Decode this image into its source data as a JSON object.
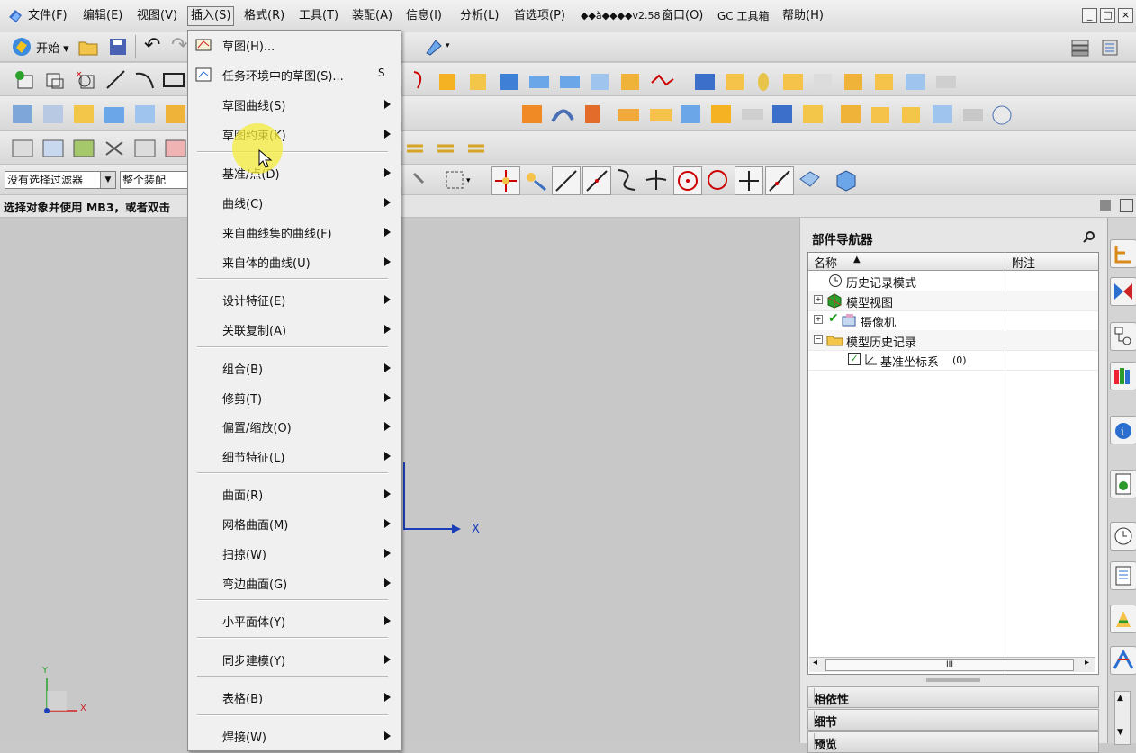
{
  "menubar": {
    "items": [
      "文件(F)",
      "编辑(E)",
      "视图(V)",
      "插入(S)",
      "格式(R)",
      "工具(T)",
      "装配(A)",
      "信息(I)",
      "分析(L)",
      "首选项(P)",
      "◆◆à◆◆◆◆v2.58",
      "窗口(O)",
      "GC 工具箱",
      "帮助(H)"
    ],
    "window_buttons": [
      "_",
      "□",
      "×"
    ]
  },
  "toolbar": {
    "start_label": "开始",
    "filter_value": "没有选择过滤器",
    "scope_value": "整个装配"
  },
  "status": {
    "text": "选择对象并使用 MB3，或者双击"
  },
  "insert_menu": {
    "items": [
      {
        "label": "草图(H)...",
        "shortcut": "",
        "sub": false
      },
      {
        "label": "任务环境中的草图(S)...",
        "shortcut": "S",
        "sub": false
      },
      {
        "label": "草图曲线(S)",
        "shortcut": "",
        "sub": true
      },
      {
        "label": "草图约束(K)",
        "shortcut": "",
        "sub": true
      },
      {
        "label": "基准/点(D)",
        "shortcut": "",
        "sub": true
      },
      {
        "label": "曲线(C)",
        "shortcut": "",
        "sub": true
      },
      {
        "label": "来自曲线集的曲线(F)",
        "shortcut": "",
        "sub": true
      },
      {
        "label": "来自体的曲线(U)",
        "shortcut": "",
        "sub": true
      },
      {
        "label": "设计特征(E)",
        "shortcut": "",
        "sub": true
      },
      {
        "label": "关联复制(A)",
        "shortcut": "",
        "sub": true
      },
      {
        "label": "组合(B)",
        "shortcut": "",
        "sub": true
      },
      {
        "label": "修剪(T)",
        "shortcut": "",
        "sub": true
      },
      {
        "label": "偏置/缩放(O)",
        "shortcut": "",
        "sub": true
      },
      {
        "label": "细节特征(L)",
        "shortcut": "",
        "sub": true
      },
      {
        "label": "曲面(R)",
        "shortcut": "",
        "sub": true
      },
      {
        "label": "网格曲面(M)",
        "shortcut": "",
        "sub": true
      },
      {
        "label": "扫掠(W)",
        "shortcut": "",
        "sub": true
      },
      {
        "label": "弯边曲面(G)",
        "shortcut": "",
        "sub": true
      },
      {
        "label": "小平面体(Y)",
        "shortcut": "",
        "sub": true
      },
      {
        "label": "同步建模(Y)",
        "shortcut": "",
        "sub": true
      },
      {
        "label": "表格(B)",
        "shortcut": "",
        "sub": true
      },
      {
        "label": "焊接(W)",
        "shortcut": "",
        "sub": true
      }
    ]
  },
  "navigator": {
    "title": "部件导航器",
    "col_name": "名称",
    "col_note": "附注",
    "rows": [
      {
        "label": "历史记录模式",
        "extra": ""
      },
      {
        "label": "模型视图",
        "extra": ""
      },
      {
        "label": "摄像机",
        "extra": ""
      },
      {
        "label": "模型历史记录",
        "extra": ""
      },
      {
        "label": "基准坐标系",
        "extra": "(0)"
      }
    ],
    "sections": [
      "相依性",
      "细节",
      "预览"
    ],
    "scroll_glyph": "III"
  },
  "viewport": {
    "axis_x": "X",
    "triad_x": "X",
    "triad_y": "Y"
  },
  "colors": {
    "menu_bg": "#f0f0f0",
    "graphics_bg": "#c8c8c8",
    "axis_blue": "#1c3fb8",
    "highlight": "#f4ec3a"
  }
}
